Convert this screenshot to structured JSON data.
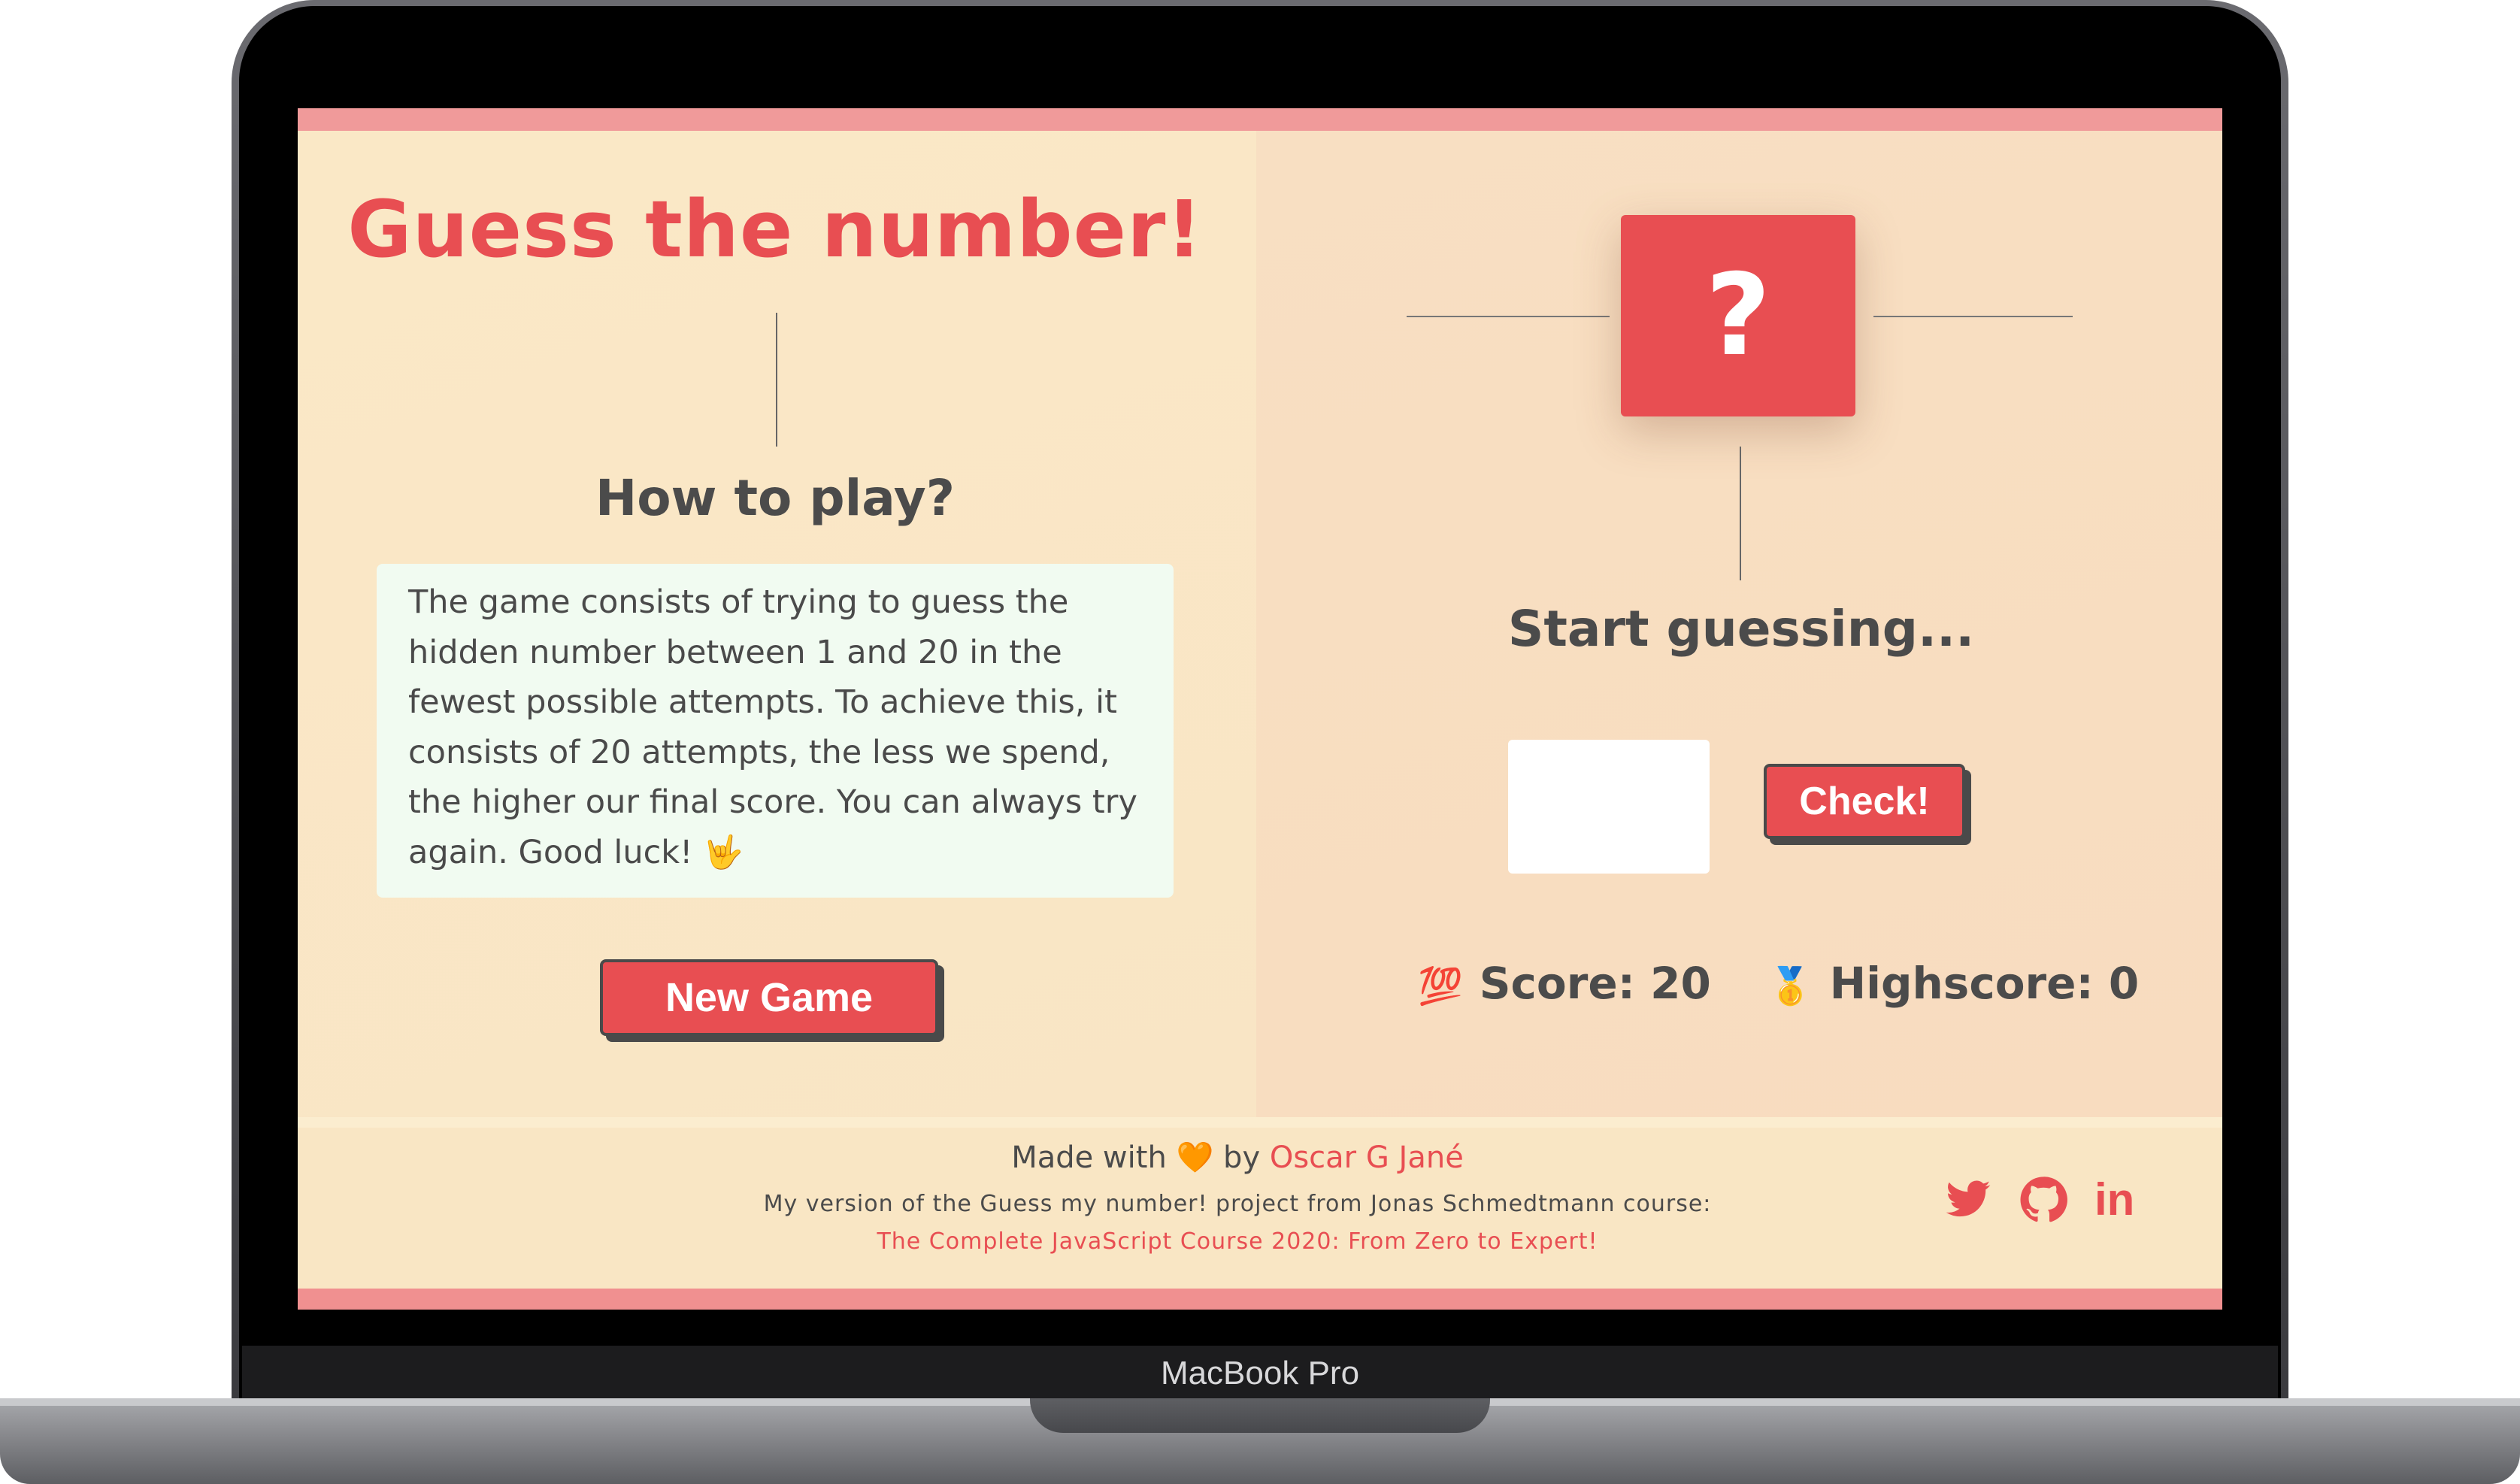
{
  "device": {
    "brand_label": "MacBook Pro"
  },
  "left": {
    "title": "Guess the number!",
    "how_title": "How to play?",
    "rules_text": "The game consists of trying to guess the hidden number between 1 and 20 in the fewest possible attempts. To achieve this, it consists of 20 attempts, the less we spend, the higher our final score. You can always try again. Good luck! 🤟",
    "new_game_label": "New Game"
  },
  "right": {
    "number_display": "?",
    "message": "Start guessing...",
    "guess_value": "",
    "check_label": "Check!",
    "score_icon": "💯",
    "score_label": "Score: 20",
    "highscore_icon": "🥇",
    "highscore_label": "Highscore: 0"
  },
  "footer": {
    "made_prefix": "Made with",
    "heart": "🧡",
    "made_by": "by",
    "author": "Oscar G Jané",
    "description": "My version of the Guess my number! project from Jonas Schmedtmann course:",
    "course_link": "The Complete JavaScript Course 2020: From Zero to Expert!",
    "social_icons": [
      "twitter-icon",
      "github-icon",
      "linkedin-icon"
    ],
    "linkedin_glyph": "in"
  },
  "colors": {
    "accent": "#e84e52",
    "top_bar": "#f09a9a",
    "left_bg": "#fae8c6",
    "right_bg": "#f8dcbf",
    "rules_bg": "#f1fbf1",
    "text": "#4b4b4b"
  }
}
